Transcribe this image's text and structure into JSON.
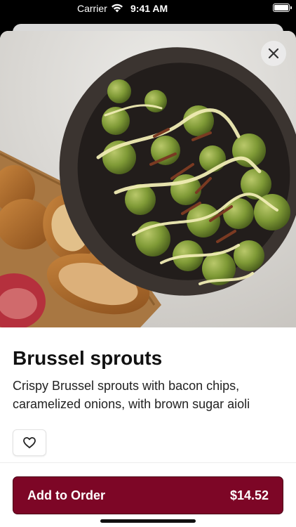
{
  "status_bar": {
    "carrier": "Carrier",
    "time": "9:41 AM",
    "wifi_icon": "wifi-icon",
    "battery_icon": "battery-icon"
  },
  "item": {
    "name": "Brussel sprouts",
    "description": "Crispy Brussel sprouts with bacon chips, caramelized onions, with brown sugar aioli",
    "photo_subject": "brussel-sprouts-photo"
  },
  "actions": {
    "close_icon": "close-icon",
    "favorite_icon": "heart-icon",
    "add_to_order_label": "Add to Order",
    "price": "$14.52"
  },
  "colors": {
    "accent": "#7d0626",
    "text": "#111111",
    "close_bg": "#ebebeb"
  }
}
